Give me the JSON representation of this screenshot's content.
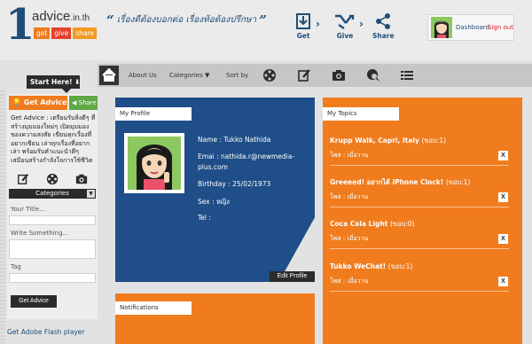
{
  "header": {
    "logo": {
      "number": "1",
      "name": "advice",
      "suffix": ".in.th",
      "tags": [
        "get",
        "give",
        "share"
      ]
    },
    "tagline": "เรื่องดีต้องบอกต่อ เรื่องท้อต้องปรึกษา",
    "actions": [
      {
        "label": "Get",
        "icon": "download-icon"
      },
      {
        "label": "Give",
        "icon": "give-icon"
      },
      {
        "label": "Share",
        "icon": "share-icon"
      }
    ],
    "user": {
      "dashboard": "Dashboard",
      "signout": "Sign out"
    }
  },
  "nav": {
    "items": [
      "About Us",
      "Categories",
      "Sort by"
    ],
    "categories_arrow": "▼",
    "icons": [
      "film-reel-icon",
      "edit-icon",
      "camera-icon",
      "chat-icon",
      "list-icon"
    ]
  },
  "left": {
    "start_here": "Start Here! ⬇",
    "get_advice_tab": "Get Advice",
    "share_tab": "Share",
    "description": "Get Advice : เตรียมรับสิ่งดีๆ ที่สร้างมุมมองใหม่ๆ เปิดมุมมองของความสงสัย เขียนทุกเรื่องที่อยากเขียน เล่าทุกเรื่องที่อยากเล่า พร้อมรับคำแนะนำดีๆ เสมือนสร้างกำลังใจการใช้ชีวิต",
    "categories": "Categories",
    "title_label": "Your Title...",
    "write_label": "Write Something...",
    "tag_label": "Tag",
    "submit": "Get Advice",
    "flash": "Get Adobe Flash player"
  },
  "profile": {
    "title": "My Profile",
    "name": "Name : Tukko Nathida",
    "email_line1": "Emai : nathida.r@newmedia-",
    "email_line2": "plus.com",
    "birthday": "Birthday : 25/02/1973",
    "sex": "Sex : หญิง",
    "tel": "Tel :",
    "edit": "Edit Profile"
  },
  "notifications": {
    "title": "Notifications"
  },
  "topics": {
    "title": "My Topics",
    "items": [
      {
        "title": "Krupp Walk, Capri, Italy",
        "count": "(ขอบ:1)",
        "sub": "โพส : เมื่อวาน"
      },
      {
        "title": "Greeeed! อยากได้ iPhone Clock!",
        "count": "(ขอบ:1)",
        "sub": "โพส : เมื่อวาน"
      },
      {
        "title": "Coca Cola Light",
        "count": "(ขอบ:0)",
        "sub": "โพส : เมื่อวาน"
      },
      {
        "title": "Tukko WeChat!",
        "count": "(ขอบ:1)",
        "sub": "โพส : เมื่อวาน"
      }
    ],
    "delete_label": "X"
  },
  "colors": {
    "orange": "#f07c1e",
    "blue": "#1f4e88",
    "dark": "#2b2b2b",
    "green": "#5fa846"
  }
}
